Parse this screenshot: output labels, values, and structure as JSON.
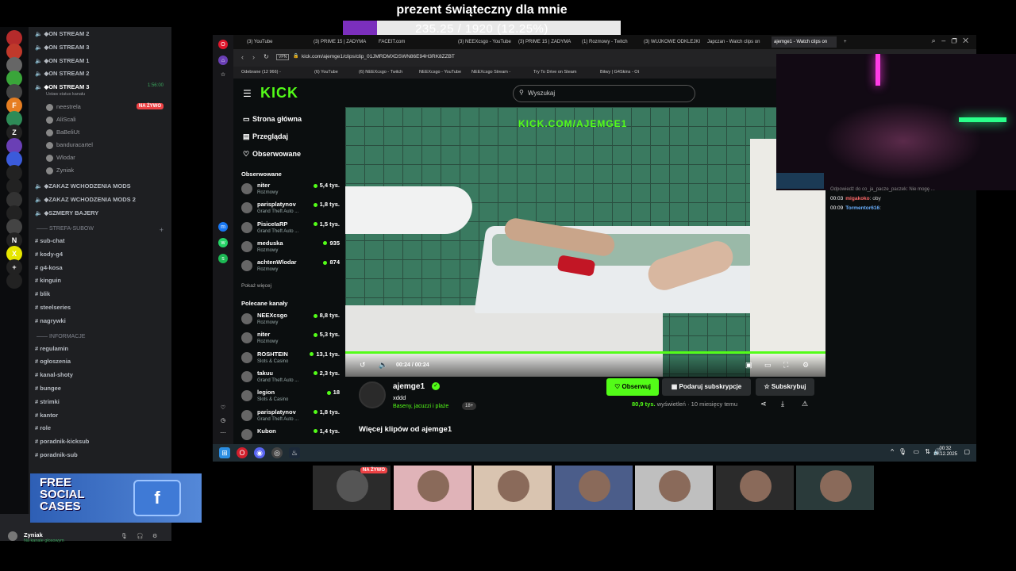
{
  "overlay": {
    "title": "prezent świąteczny dla mnie",
    "goal_text": "235.25 / 1920 (12.25%)",
    "goal_progress": 0.1225
  },
  "discord": {
    "servers": [
      {
        "icon": "skull-icon",
        "color": "#b52b2b"
      },
      {
        "icon": "santa-icon",
        "color": "#c0392b"
      },
      {
        "icon": "avatar-icon",
        "color": "#666"
      },
      {
        "icon": "lime-icon",
        "color": "#3aa53a"
      },
      {
        "icon": "cs-icon",
        "color": "#444"
      },
      {
        "icon": "f-icon",
        "color": "#e67e22",
        "label": "F"
      },
      {
        "icon": "green-server-icon",
        "color": "#2e8b57"
      },
      {
        "icon": "z-icon",
        "color": "#222",
        "label": "Z"
      },
      {
        "icon": "purple-server-icon",
        "color": "#6a3fb5"
      },
      {
        "icon": "blue-server-icon",
        "color": "#3b5bdb"
      },
      {
        "icon": "f1-icon",
        "color": "#222"
      },
      {
        "icon": "palm-icon",
        "color": "#222"
      },
      {
        "icon": "helmet-icon",
        "color": "#333"
      },
      {
        "icon": "rac-icon",
        "color": "#222"
      },
      {
        "icon": "skull2-icon",
        "color": "#444"
      },
      {
        "icon": "n-icon",
        "color": "#222",
        "label": "N"
      },
      {
        "icon": "x-icon",
        "color": "#e6e600",
        "label": "X"
      },
      {
        "icon": "add-server-icon",
        "color": "#222",
        "label": "+"
      },
      {
        "icon": "compass-icon",
        "color": "#222"
      }
    ],
    "voice_channels_top": [
      {
        "label": "◆ON STREAM 2"
      },
      {
        "label": "◆ON STREAM 3"
      },
      {
        "label": "◆ON STREAM 1"
      },
      {
        "label": "◆ON STREAM 2"
      },
      {
        "label": "◆ON STREAM 3",
        "active": true,
        "timer": "1:56:00"
      }
    ],
    "status_hint": "Ustaw status kanału",
    "voice_users": [
      {
        "name": "neestrela",
        "live": "NA ŻYWO"
      },
      {
        "name": "AliScali"
      },
      {
        "name": "BaBeliUt"
      },
      {
        "name": "banduracartel"
      },
      {
        "name": "Wlodar"
      },
      {
        "name": "Zyniak"
      }
    ],
    "voice_channels_bottom": [
      {
        "label": "◆ZAKAZ WCHODZENIA MODS"
      },
      {
        "label": "◆ZAKAZ WCHODZENIA MODS 2"
      },
      {
        "label": "◆SZMERY BAJERY"
      }
    ],
    "category_subs": "STREFA-SUBOW",
    "text_channels_subs": [
      "sub-chat",
      "kody-g4",
      "g4-kosa",
      "kinguin",
      "blik",
      "steelseries",
      "nagrywki"
    ],
    "category_info": "INFORMACJE",
    "text_channels_info": [
      "regulamin",
      "ogłoszenia",
      "kanal-shoty",
      "bungee",
      "strimki",
      "kantor",
      "role",
      "poradnik-kicksub",
      "poradnik-sub"
    ],
    "user": {
      "name": "Zyniak",
      "status": "Na kanale głosowym"
    }
  },
  "ad": {
    "text": "FREE\nSOCIAL\nCASES",
    "icon": "f"
  },
  "browser": {
    "tabs": [
      "(3) YouTube",
      "(3) PRIME 15 | ZADYMA",
      "FACEIT.com",
      "(3) NEEXcsgo - YouTube",
      "(3) PRIME 15 | ZADYMA",
      "(1) Rozmowy - Twitch",
      "(3) WUJKOWE ODKLEJKI",
      "Japczan - Watch clips on",
      "ajemge1 - Watch clips on"
    ],
    "url": "kick.com/ajemge1/clips/clip_01JMRDMXDSWN86E94H3RK8ZZBT",
    "bookmarks": [
      "Odebrane (12 966) -",
      "(6) YouTube",
      "(6) NEEXcsgo - Twitch",
      "NEEXcsgo - YouTube",
      "NEEXcsgo Stream -",
      "Try To Drive on Steam",
      "Bitwy | G4Skins - Ot"
    ]
  },
  "kick": {
    "logo": "KICK",
    "search_placeholder": "Wyszukaj",
    "nav": [
      {
        "label": "Strona główna",
        "icon": "home-icon"
      },
      {
        "label": "Przeglądaj",
        "icon": "browse-icon"
      },
      {
        "label": "Obserwowane",
        "icon": "heart-icon"
      }
    ],
    "followed_heading": "Obserwowane",
    "followed": [
      {
        "name": "niter",
        "game": "Rozmowy",
        "viewers": "5,4 tys."
      },
      {
        "name": "parisplatynov",
        "game": "Grand Theft Auto ...",
        "viewers": "1,8 tys."
      },
      {
        "name": "PisiceIaRP",
        "game": "Grand Theft Auto ...",
        "viewers": "1,5 tys."
      },
      {
        "name": "meduska",
        "game": "Rozmowy",
        "viewers": "935"
      },
      {
        "name": "achtenWlodar",
        "game": "Rozmowy",
        "viewers": "874"
      }
    ],
    "show_more": "Pokaż więcej",
    "recommended_heading": "Polecane kanały",
    "recommended": [
      {
        "name": "NEEXcsgo",
        "game": "Rozmowy",
        "viewers": "8,8 tys."
      },
      {
        "name": "niter",
        "game": "Rozmowy",
        "viewers": "5,3 tys."
      },
      {
        "name": "ROSHTEIN",
        "game": "Slots & Casino",
        "viewers": "13,1 tys."
      },
      {
        "name": "takuu",
        "game": "Grand Theft Auto ...",
        "viewers": "2,3 tys."
      },
      {
        "name": "legion",
        "game": "Slots & Casino",
        "viewers": "18"
      },
      {
        "name": "parisplatynov",
        "game": "Grand Theft Auto ...",
        "viewers": "1,8 tys."
      },
      {
        "name": "Kubon",
        "game": "",
        "viewers": "1,4 tys."
      }
    ],
    "video": {
      "watermark": "KICK.COM/AJEMGE1",
      "time": "00:24 / 00:24",
      "progress": 1.0
    },
    "channel": {
      "name": "ajemge1",
      "clip_title": "xddd",
      "category": "Baseny, jacuzzi i plaże",
      "tag": "18+",
      "follow": "Obserwuj",
      "gift": "Podaruj subskrypcje",
      "subscribe": "Subskrybuj",
      "views": "80,9 tys.",
      "views_label": "wyświetleń",
      "age": "· 10 miesięcy temu"
    },
    "more_clips": "Więcej klipów od ajemge1"
  },
  "chat": [
    {
      "time": "",
      "user": "",
      "text": "Odpowiedź do co_ja_pacze_paczek: Nie mogę ..."
    },
    {
      "time": "00:03",
      "user": "migakoko",
      "text": ": oby"
    },
    {
      "time": "00:09",
      "user": "Tormentor616",
      "text": ":"
    }
  ],
  "taskbar": {
    "time": "00:32",
    "date": "18.12.2025"
  },
  "thumbnails": [
    {
      "bg": "#2b2b2b",
      "live": "NA ŻYWO"
    },
    {
      "bg": "#e0b3b8"
    },
    {
      "bg": "#d9c4b0"
    },
    {
      "bg": "#4b5d8a"
    },
    {
      "bg": "#bfbfbf"
    },
    {
      "bg": "#2b2b2b"
    },
    {
      "bg": "#2a3a3a"
    }
  ]
}
